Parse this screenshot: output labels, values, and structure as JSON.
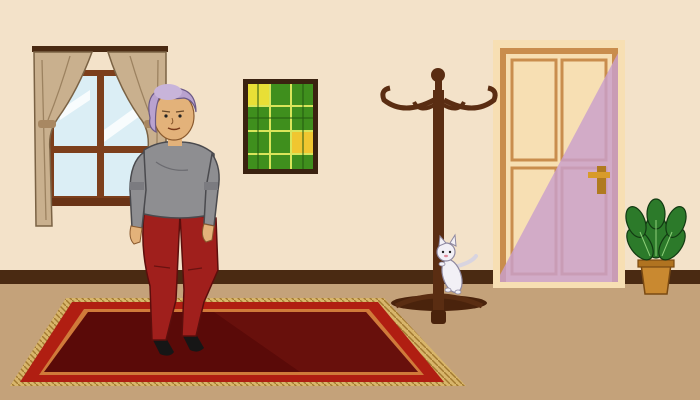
{
  "scene": {
    "type": "cartoon-interior",
    "objects": [
      "window-with-curtains",
      "green-plaid-painting",
      "elderly-woman-character",
      "red-rug",
      "coat-rack",
      "cat-climbing-rack",
      "wooden-door",
      "potted-plant"
    ]
  },
  "colors": {
    "wall": "#f3e2c9",
    "floor": "#c4a27a",
    "baseboard": "#4a2a12",
    "rug_outer": "#b01e12",
    "rug_inner": "#5a0a08",
    "door_frame": "#c98d4d",
    "door_panel": "#f7dfb3",
    "door_light": "#c9a0cc",
    "sweater": "#8e8e91",
    "pants": "#a01f1c",
    "hair": "#b9a2cf",
    "painting_green": "#3f8f1d",
    "painting_yellow": "#e8df36",
    "coat_rack": "#5a2d12"
  }
}
